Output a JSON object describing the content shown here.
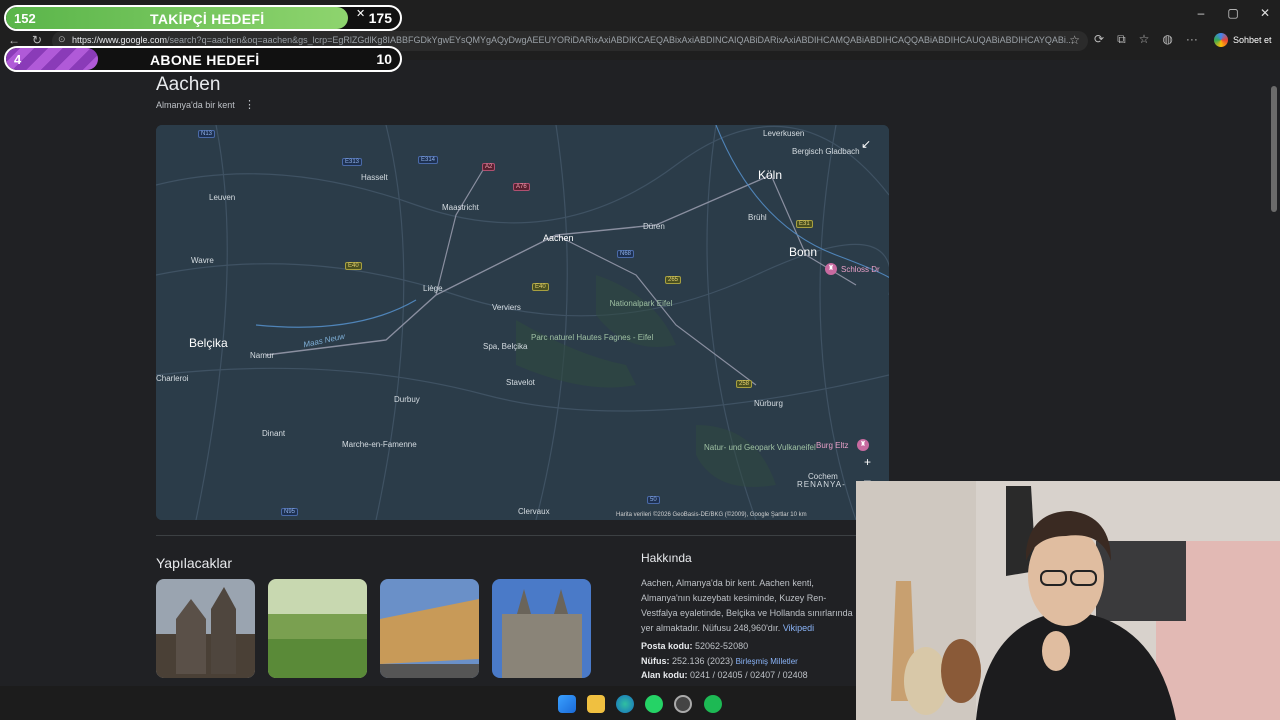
{
  "overlay": {
    "follower_goal": {
      "current": "152",
      "label": "TAKİPÇİ HEDEFİ",
      "target": "175",
      "close": "✕"
    },
    "sub_goal": {
      "current": "4",
      "label": "ABONE HEDEFİ",
      "target": "10"
    }
  },
  "browser": {
    "url_host": "https://www.google.com",
    "url_rest": "/search?q=aachen&oq=aachen&gs_lcrp=EgRlZGdlKg8IABBFGDkYgwEYsQMYgAQyDwgAEEUYORiDARixAxiABDIKCAEQABixAxiABDINCAIQABiDARixAxiABDIHCAMQABiABDIHCAQQABiABDIHCAUQABiABDIHCAYQABi...",
    "chat_label": "Sohbet et",
    "window_controls": [
      "–",
      "▢",
      "✕"
    ]
  },
  "knowledge_panel": {
    "title": "Aachen",
    "subtitle": "Almanya'da bir kent",
    "more_icon": "⋮"
  },
  "map": {
    "cities_big": [
      {
        "name": "Köln"
      },
      {
        "name": "Bonn"
      },
      {
        "name": "Belçika"
      }
    ],
    "cities": [
      "Leverkusen",
      "Bergisch Gladbach",
      "Hasselt",
      "Maastricht",
      "Leuven",
      "Aachen",
      "Düren",
      "Brühl",
      "Wavre",
      "Liège",
      "Verviers",
      "Spa, Belçika",
      "Namur",
      "Stavelot",
      "Durbuy",
      "Dinant",
      "Marche-en-Famenne",
      "Nürburg",
      "Cochem",
      "Clervaux",
      "Burg Eltz",
      "Schloss Dr",
      "Charleroi"
    ],
    "parks": [
      "Nationalpark Eifel",
      "Parc naturel Hautes Fagnes - Eifel",
      "Natur- und Geopark Vulkaneifel"
    ],
    "water": "Maas Neuw",
    "region": "RENANYA-",
    "footer": "Harita verileri ©2026 GeoBasis-DE/BKG (©2009), Google   Şartlar   10 km",
    "zoom_in": "+",
    "zoom_out": "–",
    "collapse_icon": "↙"
  },
  "things_to_do": {
    "heading": "Yapılacaklar"
  },
  "about": {
    "heading": "Hakkında",
    "text": "Aachen, Almanya'da bir kent. Aachen kenti, Almanya'nın kuzeybatı kesiminde, Kuzey Ren-Vestfalya eyaletinde, Belçika ve Hollanda sınırlarında yer almaktadır. Nüfusu 248,960'dır.",
    "source_link": "Vikipedi",
    "facts": [
      {
        "label": "Posta kodu:",
        "value": "52062-52080",
        "link": ""
      },
      {
        "label": "Nüfus:",
        "value": "252.136 (2023)",
        "link": "Birleşmiş Milletler"
      },
      {
        "label": "Alan kodu:",
        "value": "0241 / 02405 / 02407 / 02408",
        "link": ""
      }
    ]
  }
}
